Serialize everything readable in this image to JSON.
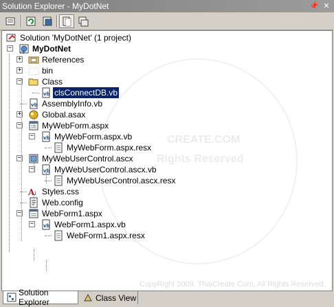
{
  "window": {
    "title": "Solution Explorer - MyDotNet",
    "pin_glyph": "—",
    "close_glyph": "✕"
  },
  "toolbar": {
    "buttons": [
      {
        "icon": "properties-icon",
        "tooltip": ""
      },
      {
        "icon": "refresh-icon",
        "tooltip": ""
      },
      {
        "icon": "copy-project-icon",
        "tooltip": ""
      },
      {
        "icon": "show-all-files-icon",
        "pressed": true
      },
      {
        "icon": "nest-related-files-icon"
      }
    ]
  },
  "tree": {
    "items": [
      {
        "label": "Solution 'MyDotNet' (1 project)",
        "icon": "solution-icon",
        "level": 0,
        "expander": ""
      },
      {
        "label": "MyDotNet",
        "icon": "web-project-icon",
        "level": 0,
        "expander": "-",
        "bold": true
      },
      {
        "label": "References",
        "icon": "references-icon",
        "level": 1,
        "expander": "+"
      },
      {
        "label": "bin",
        "icon": "folder-icon",
        "level": 1,
        "expander": "+"
      },
      {
        "label": "Class",
        "icon": "open-folder-icon",
        "level": 1,
        "expander": "-"
      },
      {
        "label": "clsConnectDB.vb",
        "icon": "vb-file-icon",
        "level": 2,
        "expander": "",
        "selected": true
      },
      {
        "label": "AssemblyInfo.vb",
        "icon": "vb-file-icon",
        "level": 1,
        "expander": ""
      },
      {
        "label": "Global.asax",
        "icon": "global-asax-icon",
        "level": 1,
        "expander": "+"
      },
      {
        "label": "MyWebForm.aspx",
        "icon": "webform-icon",
        "level": 1,
        "expander": "-"
      },
      {
        "label": "MyWebForm.aspx.vb",
        "icon": "vb-file-icon",
        "level": 2,
        "expander": "-"
      },
      {
        "label": "MyWebForm.aspx.resx",
        "icon": "resx-file-icon",
        "level": 3,
        "expander": ""
      },
      {
        "label": "MyWebUserControl.ascx",
        "icon": "user-control-icon",
        "level": 1,
        "expander": "-"
      },
      {
        "label": "MyWebUserControl.ascx.vb",
        "icon": "vb-file-icon",
        "level": 2,
        "expander": "-"
      },
      {
        "label": "MyWebUserControl.ascx.resx",
        "icon": "resx-file-icon",
        "level": 3,
        "expander": ""
      },
      {
        "label": "Styles.css",
        "icon": "css-file-icon",
        "level": 1,
        "expander": ""
      },
      {
        "label": "Web.config",
        "icon": "config-file-icon",
        "level": 1,
        "expander": ""
      },
      {
        "label": "WebForm1.aspx",
        "icon": "webform-icon",
        "level": 1,
        "expander": "-"
      },
      {
        "label": "WebForm1.aspx.vb",
        "icon": "vb-file-icon",
        "level": 2,
        "expander": "-"
      },
      {
        "label": "WebForm1.aspx.resx",
        "icon": "resx-file-icon",
        "level": 3,
        "expander": ""
      }
    ]
  },
  "watermark": {
    "copyright": "CopyRight 2009, ThaiCreate.Com, All Rights Reserved.",
    "line1": "CREATE.COM",
    "line2": "Rights Reserved"
  },
  "tabs": [
    {
      "label": "Solution Explorer",
      "icon": "solution-explorer-icon",
      "active": true
    },
    {
      "label": "Class View",
      "icon": "class-view-icon",
      "active": false
    }
  ]
}
